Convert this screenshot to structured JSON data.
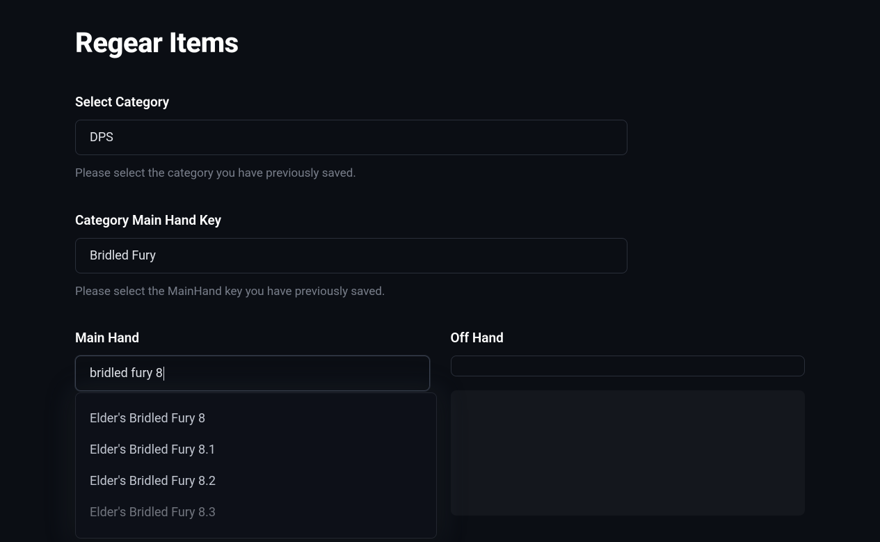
{
  "title": "Regear Items",
  "category": {
    "label": "Select Category",
    "value": "DPS",
    "help": "Please select the category you have previously saved."
  },
  "mainhand_key": {
    "label": "Category Main Hand Key",
    "value": "Bridled Fury",
    "help": "Please select the MainHand key you have previously saved."
  },
  "mainhand": {
    "label": "Main Hand",
    "input": "bridled fury 8",
    "suggestions": [
      "Elder's Bridled Fury 8",
      "Elder's Bridled Fury 8.1",
      "Elder's Bridled Fury 8.2",
      "Elder's Bridled Fury 8.3"
    ]
  },
  "offhand": {
    "label": "Off Hand",
    "input": ""
  }
}
